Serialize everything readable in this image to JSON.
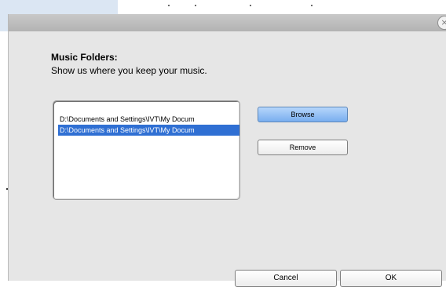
{
  "dialog": {
    "close_glyph": "×",
    "heading": "Music Folders:",
    "subheading": "Show us where you keep your music."
  },
  "folders": [
    {
      "path": "D:\\Documents and Settings\\IVT\\My Docum",
      "selected": false
    },
    {
      "path": "D:\\Documents and Settings\\IVT\\My Docum",
      "selected": true
    }
  ],
  "buttons": {
    "browse": "Browse",
    "remove": "Remove",
    "cancel": "Cancel",
    "ok": "OK"
  },
  "colors": {
    "selection": "#2f6fd3",
    "browse_button": "#79aeef",
    "dialog_bg": "#e6e6e6"
  }
}
